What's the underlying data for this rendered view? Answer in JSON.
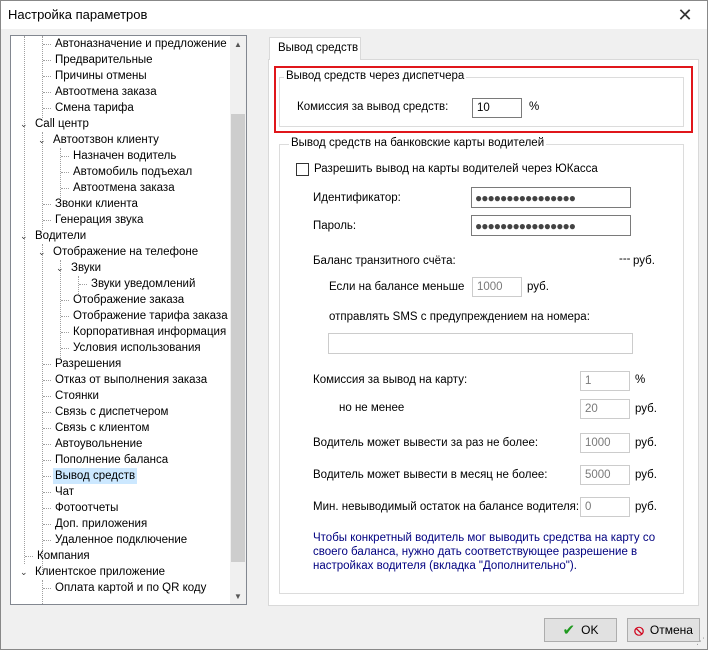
{
  "window": {
    "title": "Настройка параметров"
  },
  "tree": {
    "items": [
      {
        "label": "Автоназначение и предложение"
      },
      {
        "label": "Предварительные"
      },
      {
        "label": "Причины отмены"
      },
      {
        "label": "Автоотмена заказа"
      },
      {
        "label": "Смена тарифа"
      },
      {
        "label": "Call центр"
      },
      {
        "label": "Автоотзвон клиенту"
      },
      {
        "label": "Назначен водитель"
      },
      {
        "label": "Автомобиль подъехал"
      },
      {
        "label": "Автоотмена заказа"
      },
      {
        "label": "Звонки клиента"
      },
      {
        "label": "Генерация звука"
      },
      {
        "label": "Водители"
      },
      {
        "label": "Отображение на телефоне"
      },
      {
        "label": "Звуки"
      },
      {
        "label": "Звуки уведомлений"
      },
      {
        "label": "Отображение заказа"
      },
      {
        "label": "Отображение тарифа заказа"
      },
      {
        "label": "Корпоративная информация"
      },
      {
        "label": "Условия использования"
      },
      {
        "label": "Разрешения"
      },
      {
        "label": "Отказ от выполнения заказа"
      },
      {
        "label": "Стоянки"
      },
      {
        "label": "Связь с диспетчером"
      },
      {
        "label": "Связь с клиентом"
      },
      {
        "label": "Автоувольнение"
      },
      {
        "label": "Пополнение баланса"
      },
      {
        "label": "Вывод средств"
      },
      {
        "label": "Чат"
      },
      {
        "label": "Фотоотчеты"
      },
      {
        "label": "Доп. приложения"
      },
      {
        "label": "Удаленное подключение"
      },
      {
        "label": "Компания"
      },
      {
        "label": "Клиентское приложение"
      },
      {
        "label": "Оплата картой и по QR коду"
      }
    ]
  },
  "tab": {
    "label": "Вывод средств"
  },
  "dispatcher_group": {
    "title": "Вывод средств через диспетчера",
    "commission_label": "Комиссия за вывод средств:",
    "commission_value": "10",
    "commission_unit": "%"
  },
  "cards_group": {
    "title": "Вывод средств на банковские карты водителей",
    "allow_label": "Разрешить вывод на карты водителей через ЮКасса",
    "allow_checked": false,
    "id_label": "Идентификатор:",
    "id_value": "●●●●●●●●●●●●●●●●",
    "password_label": "Пароль:",
    "password_value": "●●●●●●●●●●●●●●●●",
    "balance_label": "Баланс транзитного счёта:",
    "balance_value": "---",
    "balance_unit": "руб.",
    "min_balance_label": "Если на балансе меньше",
    "min_balance_value": "1000",
    "min_balance_unit": "руб.",
    "sms_label": "отправлять SMS с предупреждением на номера:",
    "sms_value": "",
    "card_commission_label": "Комиссия за вывод на карту:",
    "card_commission_value": "1",
    "card_commission_unit": "%",
    "not_less_label": "но не менее",
    "not_less_value": "20",
    "not_less_unit": "руб.",
    "per_withdrawal_label": "Водитель может вывести за раз не более:",
    "per_withdrawal_value": "1000",
    "per_withdrawal_unit": "руб.",
    "per_month_label": "Водитель может вывести в месяц не более:",
    "per_month_value": "5000",
    "per_month_unit": "руб.",
    "min_remain_label": "Мин. невыводимый остаток на балансе водителя:",
    "min_remain_value": "0",
    "min_remain_unit": "руб.",
    "note": "Чтобы конкретный водитель мог выводить средства на карту со своего баланса, нужно дать соответствующее разрешение в настройках водителя (вкладка \"Дополнительно\")."
  },
  "buttons": {
    "ok": "OK",
    "cancel": "Отмена"
  },
  "colors": {
    "highlight": "#e0161b",
    "note": "#000080",
    "selection": "#cce8ff"
  }
}
